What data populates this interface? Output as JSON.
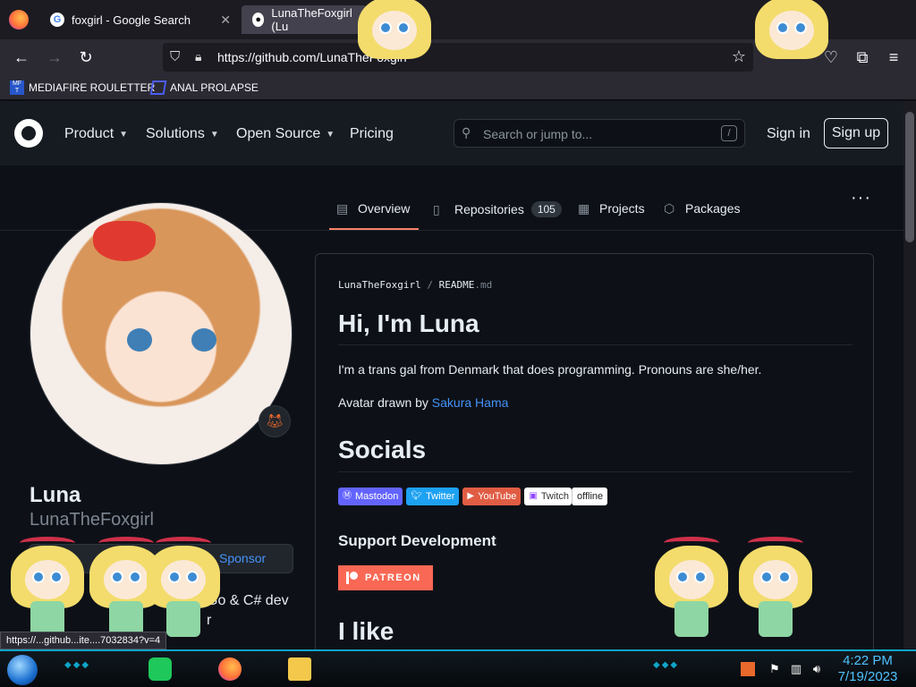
{
  "browser": {
    "tabs": [
      {
        "title": "foxgirl - Google Search",
        "favicon": "google-icon"
      },
      {
        "title": "LunaTheFoxgirl (Lu",
        "favicon": "github-icon"
      }
    ],
    "url": "https://github.com/LunaTheFoxgirl",
    "bookmarks": [
      {
        "label": "MEDIAFIRE ROULETTER",
        "icon_text": "MF T"
      },
      {
        "label": "ANAL PROLAPSE"
      }
    ]
  },
  "github": {
    "nav": {
      "product": "Product",
      "solutions": "Solutions",
      "open_source": "Open Source",
      "pricing": "Pricing"
    },
    "search_placeholder": "Search or jump to...",
    "search_shortcut": "/",
    "sign_in": "Sign in",
    "sign_up": "Sign up",
    "tabs": {
      "overview": "Overview",
      "repositories": "Repositories",
      "repositories_count": "105",
      "projects": "Projects",
      "packages": "Packages"
    },
    "more": "···"
  },
  "profile": {
    "name": "Luna",
    "username": "LunaTheFoxgirl",
    "sponsor_label": "Sponsor",
    "bio_fragment": "Go & C# dev",
    "bio_fragment2": "r"
  },
  "readme": {
    "path_owner": "LunaTheFoxgirl",
    "path_sep": "/",
    "path_file": "README",
    "path_ext": ".md",
    "heading": "Hi, I'm Luna",
    "intro": "I'm a trans gal from Denmark that does programming. Pronouns are she/her.",
    "avatar_credit_prefix": "Avatar drawn by ",
    "avatar_credit_link": "Sakura Hama",
    "socials_heading": "Socials",
    "badges": {
      "mastodon": "Mastodon",
      "twitter": "Twitter",
      "youtube": "YouTube",
      "twitch": "Twitch",
      "twitch_status": "offline"
    },
    "support_heading": "Support Development",
    "patreon": "PATREON",
    "like_heading": "I like"
  },
  "status_url": "https://...github...ite....7032834?v=4",
  "taskbar": {
    "time": "4:22 PM",
    "date": "7/19/2023"
  },
  "colors": {
    "page_bg": "#0d1117",
    "header_bg": "#161b22",
    "link": "#4493f8",
    "tab_underline": "#f78166",
    "patreon": "#f96854",
    "taskbar_accent": "#0fa5c9"
  }
}
